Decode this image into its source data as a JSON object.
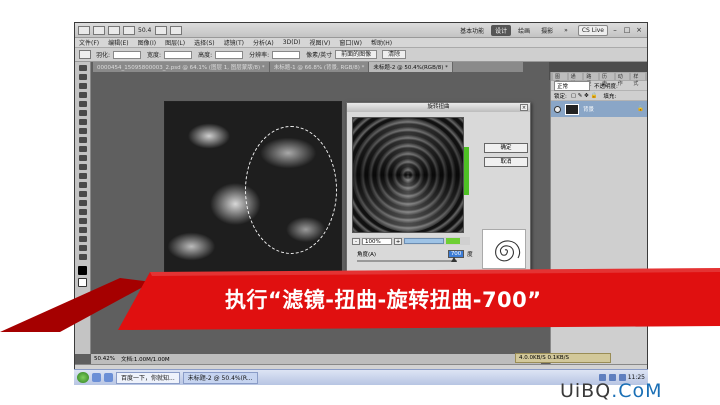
{
  "app": {
    "workspaces": [
      "基本功能",
      "设计",
      "绘画",
      "摄影"
    ],
    "active_workspace": "设计",
    "more": "»",
    "cs_live": "CS Live",
    "window_controls": [
      "–",
      "□",
      "×"
    ],
    "zoom_display": "50.4"
  },
  "menu": [
    "文件(F)",
    "编辑(E)",
    "图像(I)",
    "图层(L)",
    "选择(S)",
    "滤镜(T)",
    "分析(A)",
    "3D(D)",
    "视图(V)",
    "窗口(W)",
    "帮助(H)"
  ],
  "options": {
    "feather_label": "羽化:",
    "width_label": "宽度:",
    "height_label": "高度:",
    "resolution_label": "分辨率:",
    "unit": "像素/英寸",
    "front_image_button": "前面的图像",
    "clear_button": "清除"
  },
  "tabs": [
    {
      "label": "0000454_15095800003_2.psd @ 64.1% (图层 1, 图层蒙版/8) *",
      "active": false
    },
    {
      "label": "未标题-1 @ 66.8% (背景, RGB/8) *",
      "active": false
    },
    {
      "label": "未标题-2 @ 50.4%(RGB/8) *",
      "active": true
    }
  ],
  "layers_panel": {
    "tabs": [
      "图层",
      "通道",
      "路径",
      "历史",
      "动作",
      "样式"
    ],
    "blend_mode": "正常",
    "opacity_label": "不透明度:",
    "lock_label": "锁定:",
    "fill_label": "填充:",
    "layer_name": "背景"
  },
  "dialog": {
    "title": "旋转扭曲",
    "close": "×",
    "ok_button": "确定",
    "cancel_button": "取消",
    "zoom_minus": "-",
    "zoom_value": "100%",
    "zoom_plus": "+",
    "angle_label": "角度(A)",
    "angle_value": "700",
    "angle_unit": "度",
    "angle_fraction": 0.972
  },
  "status": {
    "zoom": "50.42%",
    "doc": "文档:1.00M/1.00M"
  },
  "bottom_strip": "4.0.0KB/S 0.1KB/S",
  "taskbar": {
    "tasks": [
      {
        "label": "百度一下，你就知...",
        "active": false
      },
      {
        "label": "未标题-2 @ 50.4%(R...",
        "active": true
      }
    ],
    "clock": "11:25"
  },
  "caption": "执行“滤镜-扭曲-旋转扭曲-700”",
  "watermark": {
    "prefix": "UiBQ",
    "suffix": ".CoM"
  },
  "colors": {
    "banner_red": "#e01010",
    "banner_dark": "#a50000",
    "accent_green": "#5fbf2f"
  }
}
